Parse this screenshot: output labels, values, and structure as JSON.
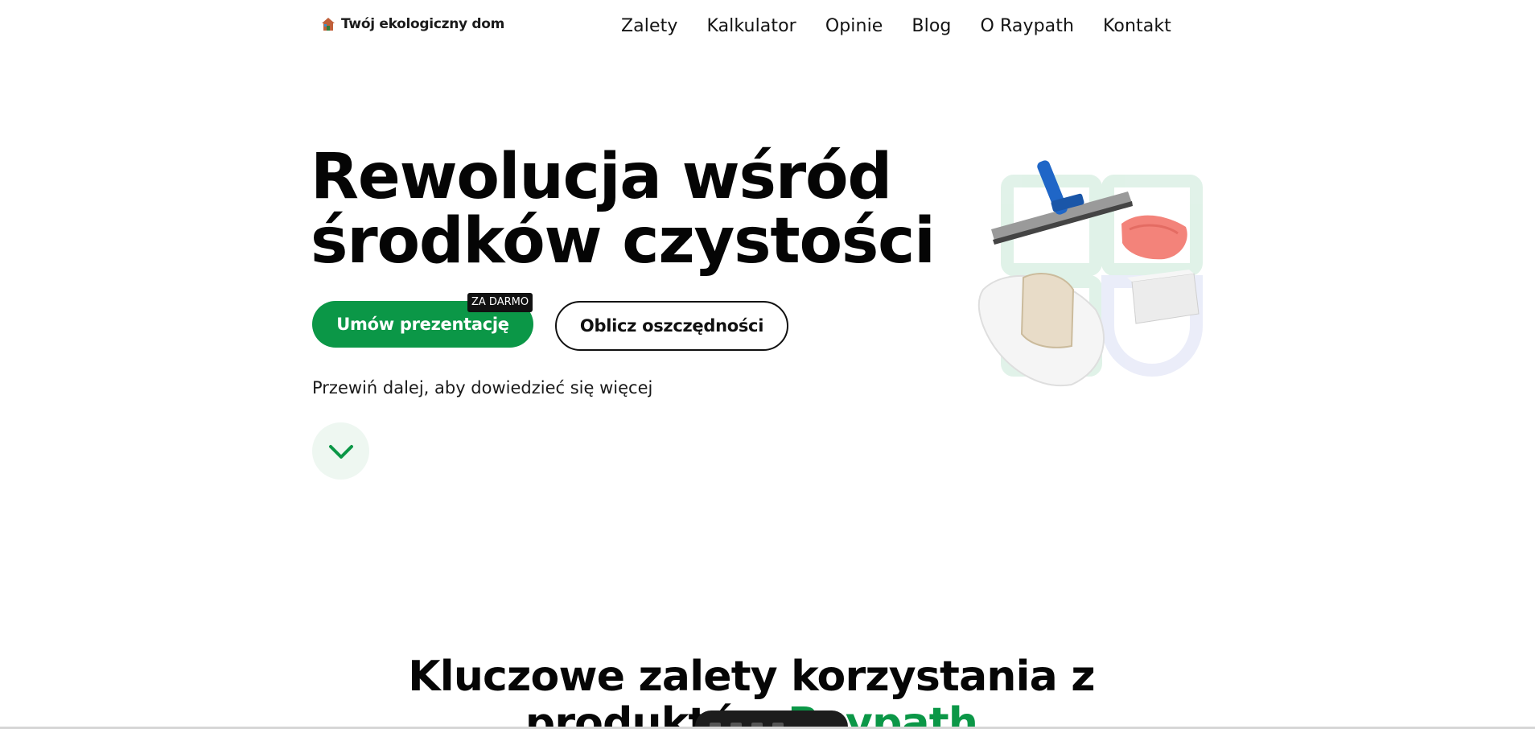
{
  "logo": {
    "text": "Twój ekologiczny dom",
    "icon": "house-icon"
  },
  "nav": {
    "items": [
      {
        "label": "Zalety"
      },
      {
        "label": "Kalkulator"
      },
      {
        "label": "Opinie"
      },
      {
        "label": "Blog"
      },
      {
        "label": "O Raypath"
      },
      {
        "label": "Kontakt"
      }
    ]
  },
  "hero": {
    "title_line1": "Rewolucja wśród",
    "title_line2": "środków czystości",
    "primary_button": "Umów prezentację",
    "badge": "ZA DARMO",
    "secondary_button": "Oblicz oszczędności",
    "scroll_hint": "Przewiń dalej, aby dowiedzieć się więcej",
    "scroll_icon": "chevron-down-icon"
  },
  "section": {
    "title_part1": "Kluczowe zalety korzystania z",
    "title_part2": "produktów",
    "brand": "Raypath"
  },
  "colors": {
    "accent": "#0b9747",
    "text": "#111111",
    "badge_bg": "#111111",
    "scroll_bg": "#eef7f1"
  }
}
